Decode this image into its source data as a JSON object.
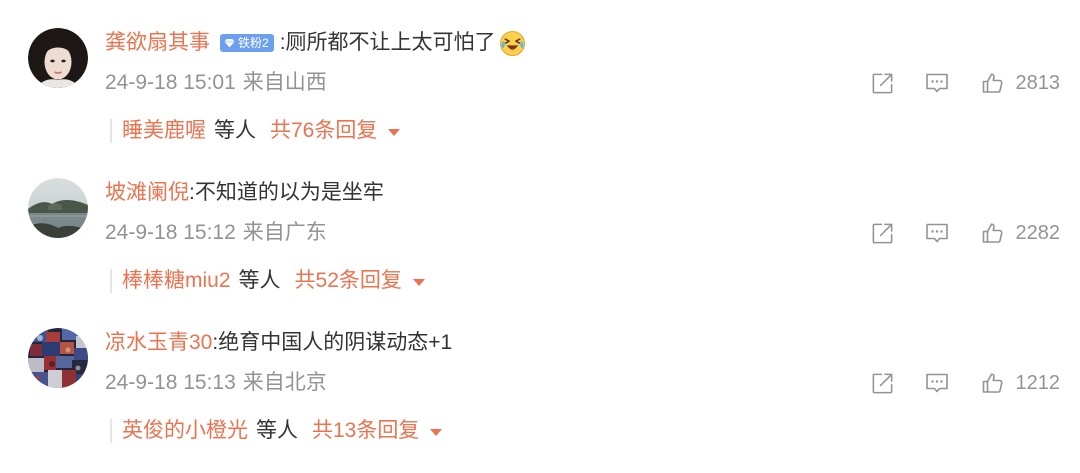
{
  "colors": {
    "accent": "#eb7350",
    "text": "#333333",
    "muted": "#939393",
    "badge": "#6c9ff0",
    "divider": "#e5e5e5"
  },
  "icons": {
    "share": "share-icon",
    "comment": "comment-icon",
    "like": "like-icon",
    "expand": "triangle-down-icon",
    "badge": "diamond-icon"
  },
  "comments": [
    {
      "user": "龚欲扇其事",
      "badge": "铁粉2",
      "text": ":厕所都不让上太可怕了",
      "emoji": "laugh-cry-emoji",
      "time": "24-9-18 15:01",
      "source": "来自山西",
      "likes": "2813",
      "reply": {
        "user": "睡美鹿喔",
        "suffix": "等人",
        "count": "共76条回复"
      }
    },
    {
      "user": "坡滩阑倪",
      "text": ":不知道的以为是坐牢",
      "time": "24-9-18 15:12",
      "source": "来自广东",
      "likes": "2282",
      "reply": {
        "user": "棒棒糖miu2",
        "suffix": "等人",
        "count": "共52条回复"
      }
    },
    {
      "user": "凉水玉青30",
      "text": ":绝育中国人的阴谋动态+1",
      "time": "24-9-18 15:13",
      "source": "来自北京",
      "likes": "1212",
      "reply": {
        "user": "英俊的小橙光",
        "suffix": "等人",
        "count": "共13条回复"
      }
    }
  ]
}
